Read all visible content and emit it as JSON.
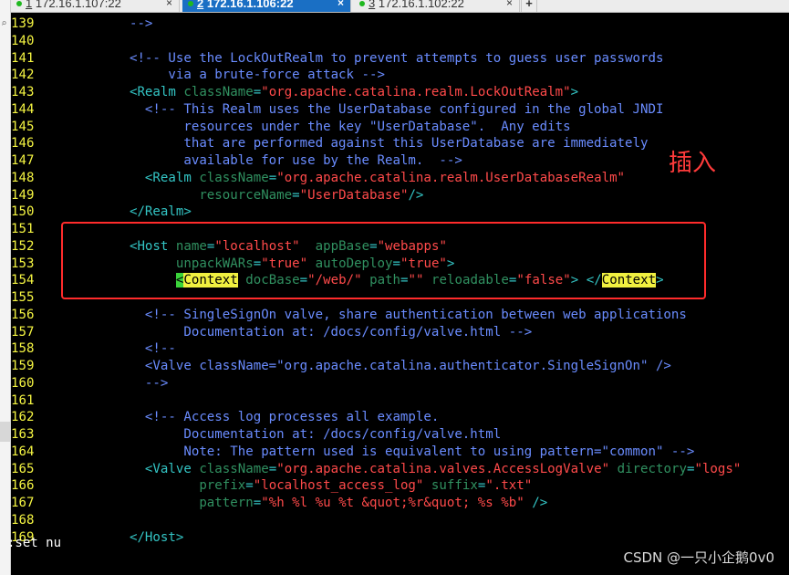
{
  "tabs": [
    {
      "number": "1",
      "label": "172.16.1.107:22",
      "active": false
    },
    {
      "number": "2",
      "label": "172.16.1.106:22",
      "active": true
    },
    {
      "number": "3",
      "label": "172.16.1.102:22",
      "active": false
    }
  ],
  "tab_close_symbol": "×",
  "tab_add_symbol": "+",
  "annotation": "插入",
  "command_line": ":set nu",
  "watermark": "CSDN @一只小企鹅0v0",
  "colors": {
    "line_number": "#f5f542",
    "comment": "#6a8cff",
    "tag": "#33c4c4",
    "attribute": "#309060",
    "string": "#ff4a4a",
    "match_highlight": "#f0f040",
    "cursor": "#3ad33a",
    "annotation_box": "#ff2b2b"
  },
  "lines": [
    {
      "n": "139",
      "segs": [
        {
          "t": "-->",
          "c": "c"
        }
      ],
      "indent": "    "
    },
    {
      "n": "140",
      "segs": [],
      "indent": ""
    },
    {
      "n": "141",
      "segs": [
        {
          "t": "<!-- Use the LockOutRealm to prevent attempts to guess user passwords",
          "c": "c"
        }
      ],
      "indent": "    "
    },
    {
      "n": "142",
      "segs": [
        {
          "t": "via a brute-force attack -->",
          "c": "c"
        }
      ],
      "indent": "         "
    },
    {
      "n": "143",
      "segs": [
        {
          "t": "<Realm ",
          "c": "t"
        },
        {
          "t": "className",
          "c": "a"
        },
        {
          "t": "=",
          "c": "t"
        },
        {
          "t": "\"org.apache.catalina.realm.LockOutRealm\"",
          "c": "s"
        },
        {
          "t": ">",
          "c": "t"
        }
      ],
      "indent": "    "
    },
    {
      "n": "144",
      "segs": [
        {
          "t": "<!-- This Realm uses the UserDatabase configured in the global JNDI",
          "c": "c"
        }
      ],
      "indent": "      "
    },
    {
      "n": "145",
      "segs": [
        {
          "t": "resources under the key \"UserDatabase\".  Any edits",
          "c": "c"
        }
      ],
      "indent": "           "
    },
    {
      "n": "146",
      "segs": [
        {
          "t": "that are performed against this UserDatabase are immediately",
          "c": "c"
        }
      ],
      "indent": "           "
    },
    {
      "n": "147",
      "segs": [
        {
          "t": "available for use by the Realm.  -->",
          "c": "c"
        }
      ],
      "indent": "           "
    },
    {
      "n": "148",
      "segs": [
        {
          "t": "<Realm ",
          "c": "t"
        },
        {
          "t": "className",
          "c": "a"
        },
        {
          "t": "=",
          "c": "t"
        },
        {
          "t": "\"org.apache.catalina.realm.UserDatabaseRealm\"",
          "c": "s"
        }
      ],
      "indent": "      "
    },
    {
      "n": "149",
      "segs": [
        {
          "t": "resourceName",
          "c": "a"
        },
        {
          "t": "=",
          "c": "t"
        },
        {
          "t": "\"UserDatabase\"",
          "c": "s"
        },
        {
          "t": "/>",
          "c": "t"
        }
      ],
      "indent": "             "
    },
    {
      "n": "150",
      "segs": [
        {
          "t": "</Realm>",
          "c": "t"
        }
      ],
      "indent": "    "
    },
    {
      "n": "151",
      "segs": [],
      "indent": ""
    },
    {
      "n": "152",
      "segs": [
        {
          "t": "<Host ",
          "c": "t"
        },
        {
          "t": "name",
          "c": "a"
        },
        {
          "t": "=",
          "c": "t"
        },
        {
          "t": "\"localhost\"",
          "c": "s"
        },
        {
          "t": "  ",
          "c": "t"
        },
        {
          "t": "appBase",
          "c": "a"
        },
        {
          "t": "=",
          "c": "t"
        },
        {
          "t": "\"webapps\"",
          "c": "s"
        }
      ],
      "indent": "    "
    },
    {
      "n": "153",
      "segs": [
        {
          "t": "unpackWARs",
          "c": "a"
        },
        {
          "t": "=",
          "c": "t"
        },
        {
          "t": "\"true\"",
          "c": "s"
        },
        {
          "t": " ",
          "c": "t"
        },
        {
          "t": "autoDeploy",
          "c": "a"
        },
        {
          "t": "=",
          "c": "t"
        },
        {
          "t": "\"true\"",
          "c": "s"
        },
        {
          "t": ">",
          "c": "t"
        }
      ],
      "indent": "          "
    },
    {
      "n": "154",
      "segs": [
        {
          "t": "<",
          "c": "cur"
        },
        {
          "t": "Context",
          "c": "hl"
        },
        {
          "t": " ",
          "c": "t"
        },
        {
          "t": "docBase",
          "c": "a"
        },
        {
          "t": "=",
          "c": "t"
        },
        {
          "t": "\"/web/\"",
          "c": "s"
        },
        {
          "t": " ",
          "c": "t"
        },
        {
          "t": "path",
          "c": "a"
        },
        {
          "t": "=",
          "c": "t"
        },
        {
          "t": "\"\"",
          "c": "s"
        },
        {
          "t": " ",
          "c": "t"
        },
        {
          "t": "reloadable",
          "c": "a"
        },
        {
          "t": "=",
          "c": "t"
        },
        {
          "t": "\"false\"",
          "c": "s"
        },
        {
          "t": "> </",
          "c": "t"
        },
        {
          "t": "Context",
          "c": "hl"
        },
        {
          "t": ">",
          "c": "t"
        }
      ],
      "indent": "          "
    },
    {
      "n": "155",
      "segs": [],
      "indent": ""
    },
    {
      "n": "156",
      "segs": [
        {
          "t": "<!-- SingleSignOn valve, share authentication between web applications",
          "c": "c"
        }
      ],
      "indent": "      "
    },
    {
      "n": "157",
      "segs": [
        {
          "t": "Documentation at: /docs/config/valve.html -->",
          "c": "c"
        }
      ],
      "indent": "           "
    },
    {
      "n": "158",
      "segs": [
        {
          "t": "<!--",
          "c": "c"
        }
      ],
      "indent": "      "
    },
    {
      "n": "159",
      "segs": [
        {
          "t": "<Valve className=\"org.apache.catalina.authenticator.SingleSignOn\" />",
          "c": "c"
        }
      ],
      "indent": "      "
    },
    {
      "n": "160",
      "segs": [
        {
          "t": "-->",
          "c": "c"
        }
      ],
      "indent": "      "
    },
    {
      "n": "161",
      "segs": [],
      "indent": ""
    },
    {
      "n": "162",
      "segs": [
        {
          "t": "<!-- Access log processes all example.",
          "c": "c"
        }
      ],
      "indent": "      "
    },
    {
      "n": "163",
      "segs": [
        {
          "t": "Documentation at: /docs/config/valve.html",
          "c": "c"
        }
      ],
      "indent": "           "
    },
    {
      "n": "164",
      "segs": [
        {
          "t": "Note: The pattern used is equivalent to using pattern=\"common\" -->",
          "c": "c"
        }
      ],
      "indent": "           "
    },
    {
      "n": "165",
      "segs": [
        {
          "t": "<Valve ",
          "c": "t"
        },
        {
          "t": "className",
          "c": "a"
        },
        {
          "t": "=",
          "c": "t"
        },
        {
          "t": "\"org.apache.catalina.valves.AccessLogValve\"",
          "c": "s"
        },
        {
          "t": " ",
          "c": "t"
        },
        {
          "t": "directory",
          "c": "a"
        },
        {
          "t": "=",
          "c": "t"
        },
        {
          "t": "\"logs\"",
          "c": "s"
        }
      ],
      "indent": "      "
    },
    {
      "n": "166",
      "segs": [
        {
          "t": "prefix",
          "c": "a"
        },
        {
          "t": "=",
          "c": "t"
        },
        {
          "t": "\"localhost_access_log\"",
          "c": "s"
        },
        {
          "t": " ",
          "c": "t"
        },
        {
          "t": "suffix",
          "c": "a"
        },
        {
          "t": "=",
          "c": "t"
        },
        {
          "t": "\".txt\"",
          "c": "s"
        }
      ],
      "indent": "             "
    },
    {
      "n": "167",
      "segs": [
        {
          "t": "pattern",
          "c": "a"
        },
        {
          "t": "=",
          "c": "t"
        },
        {
          "t": "\"%h %l %u %t &quot;%r&quot; %s %b\"",
          "c": "s"
        },
        {
          "t": " />",
          "c": "t"
        }
      ],
      "indent": "             "
    },
    {
      "n": "168",
      "segs": [],
      "indent": ""
    },
    {
      "n": "169",
      "segs": [
        {
          "t": "</Host>",
          "c": "t"
        }
      ],
      "indent": "    "
    }
  ]
}
